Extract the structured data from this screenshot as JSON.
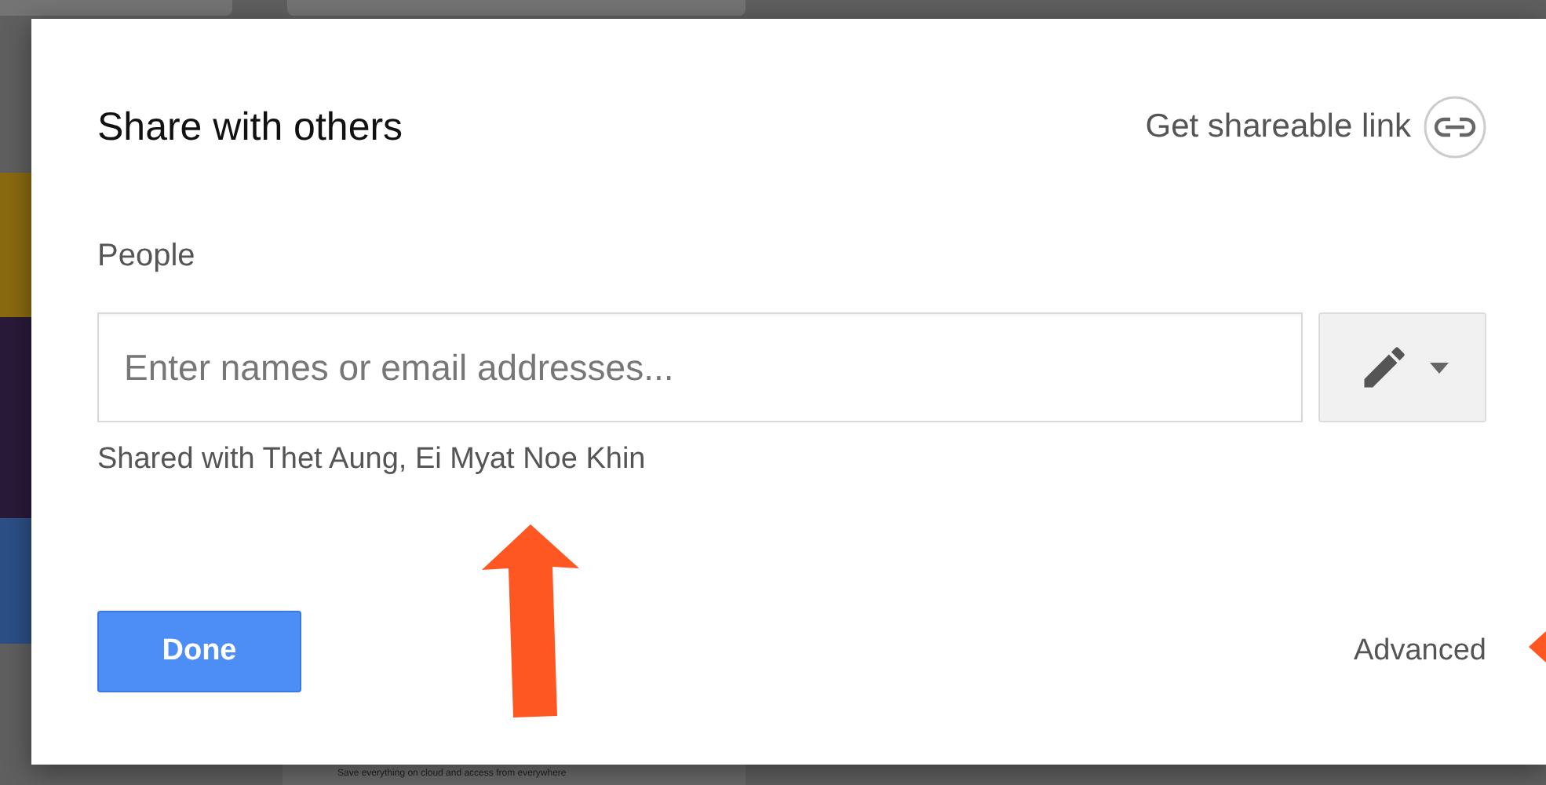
{
  "background": {
    "caption": "Save everything on cloud and access from everywhere"
  },
  "dialog": {
    "title": "Share with others",
    "share_link": {
      "label": "Get shareable link"
    },
    "people": {
      "label": "People",
      "placeholder": "Enter names or email addresses..."
    },
    "shared_with": "Shared with Thet Aung, Ei Myat Noe Khin",
    "buttons": {
      "done": "Done",
      "advanced": "Advanced"
    }
  }
}
